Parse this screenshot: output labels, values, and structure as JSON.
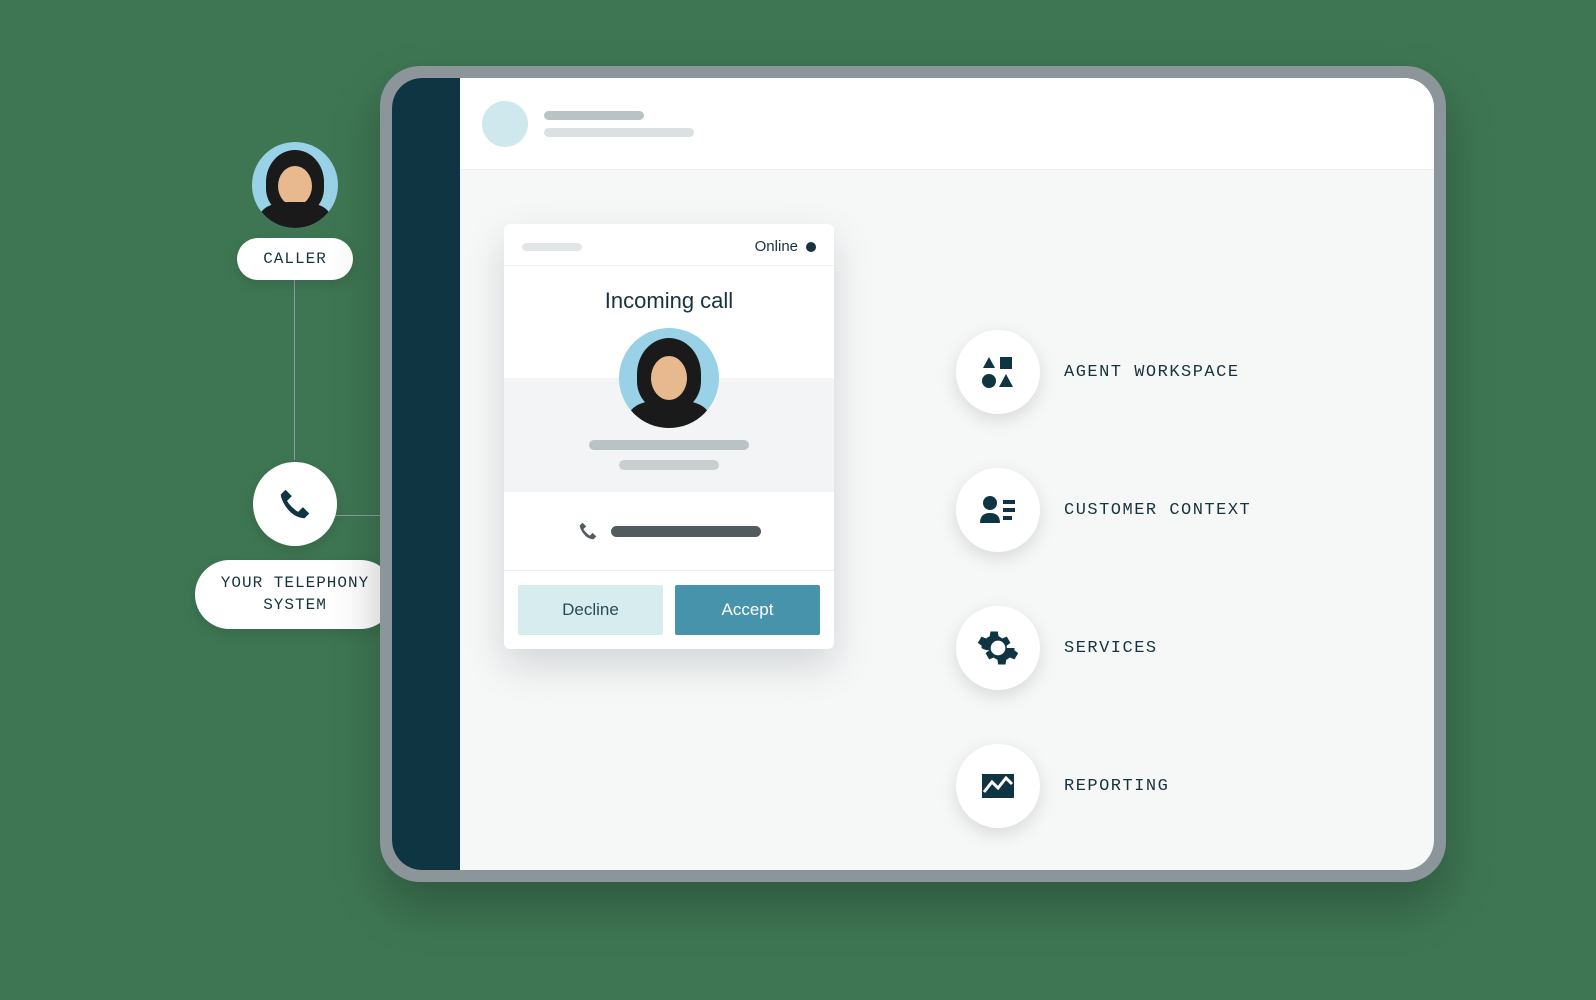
{
  "left": {
    "caller_label": "CALLER",
    "telephony_label": "YOUR TELEPHONY\nSYSTEM"
  },
  "call_card": {
    "status_label": "Online",
    "title": "Incoming call",
    "decline_label": "Decline",
    "accept_label": "Accept"
  },
  "features": [
    {
      "icon": "shapes",
      "label": "AGENT WORKSPACE"
    },
    {
      "icon": "person",
      "label": "CUSTOMER CONTEXT"
    },
    {
      "icon": "gear",
      "label": "SERVICES"
    },
    {
      "icon": "chart",
      "label": "REPORTING"
    }
  ]
}
